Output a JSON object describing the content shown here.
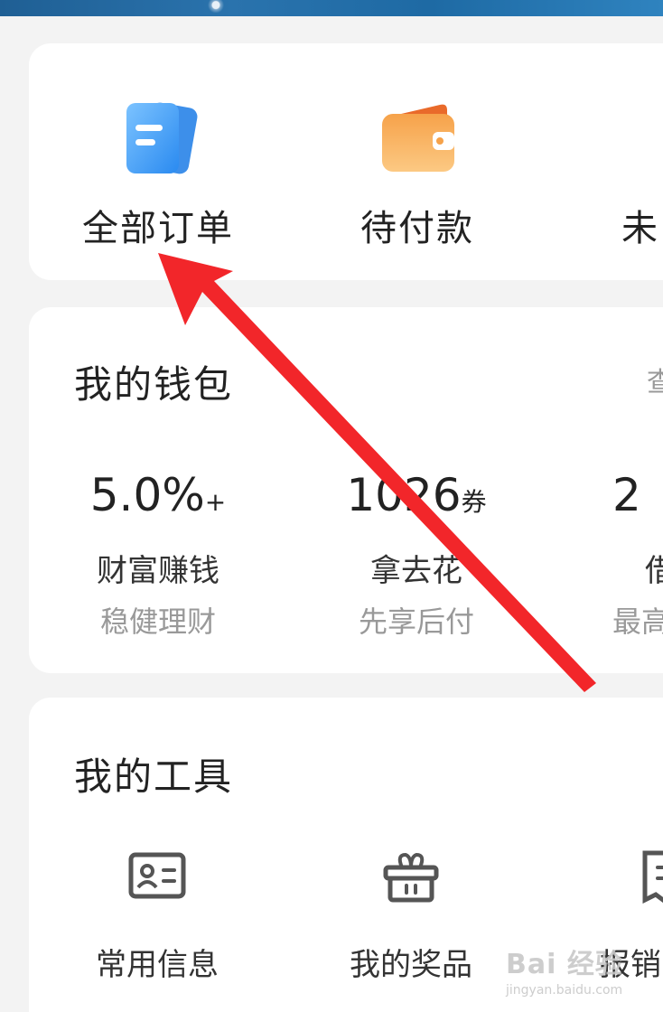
{
  "orders": {
    "items": [
      {
        "label": "全部订单",
        "icon": "document-list-icon",
        "color": "#3c9cf0"
      },
      {
        "label": "待付款",
        "icon": "wallet-icon",
        "color": "#f79a3c"
      },
      {
        "label": "未",
        "icon": "tile-icon",
        "color": "#33c7ea"
      }
    ]
  },
  "wallet": {
    "title": "我的钱包",
    "link": "查",
    "items": [
      {
        "value": "5.0%",
        "unit": "+",
        "name": "财富赚钱",
        "sub": "稳健理财"
      },
      {
        "value": "1026",
        "unit": "券",
        "name": "拿去花",
        "sub": "先享后付"
      },
      {
        "value": "2",
        "unit": "",
        "name": "借",
        "sub": "最高"
      }
    ]
  },
  "tools": {
    "title": "我的工具",
    "items": [
      {
        "label": "常用信息",
        "icon": "id-card-icon"
      },
      {
        "label": "我的奖品",
        "icon": "gift-icon"
      },
      {
        "label": "报销",
        "icon": "receipt-icon"
      }
    ]
  },
  "watermark": {
    "logo": "Bai 经验",
    "url": "jingyan.baidu.com"
  },
  "colors": {
    "arrow": "#f2262a",
    "card": "#ffffff",
    "page_bg": "#f3f3f3"
  }
}
